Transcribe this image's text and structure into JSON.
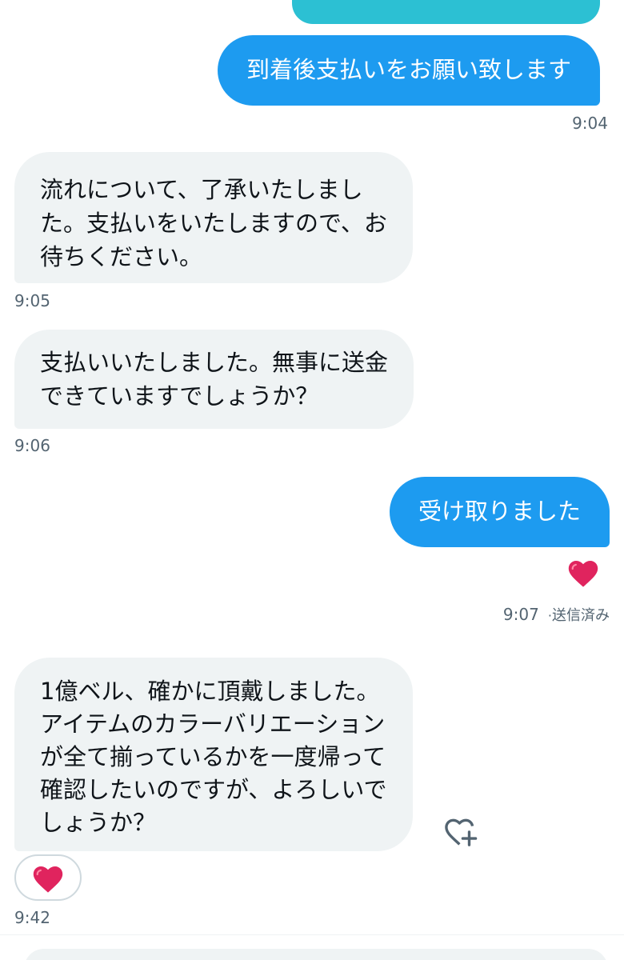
{
  "colors": {
    "sent_bubble": "#1d9bf0",
    "received_bubble": "#eff3f4",
    "timestamp": "#536471",
    "heart": "#e0245e"
  },
  "messages": [
    {
      "direction": "sent",
      "lines": [
        "到着後支払いをお願い致します"
      ],
      "time": "9:04"
    },
    {
      "direction": "received",
      "lines": [
        "流れについて、了承いたしまし",
        "た。支払いをいたしますので、お",
        "待ちください。"
      ],
      "time": "9:05"
    },
    {
      "direction": "received",
      "lines": [
        "支払いいたしました。無事に送金",
        "できていますでしょうか？"
      ],
      "time": "9:06"
    },
    {
      "direction": "sent",
      "lines": [
        "受け取りました"
      ],
      "time": "9:07",
      "status": "送信済み",
      "reaction": "heart-icon"
    },
    {
      "direction": "received",
      "lines": [
        "1億ベル、確かに頂戴しました。",
        "アイテムのカラーバリエーション",
        "が全て揃っているかを一度帰って",
        "確認したいのですが、よろしいで",
        "しょうか？"
      ],
      "time": "9:42",
      "reaction": "heart-icon"
    }
  ]
}
